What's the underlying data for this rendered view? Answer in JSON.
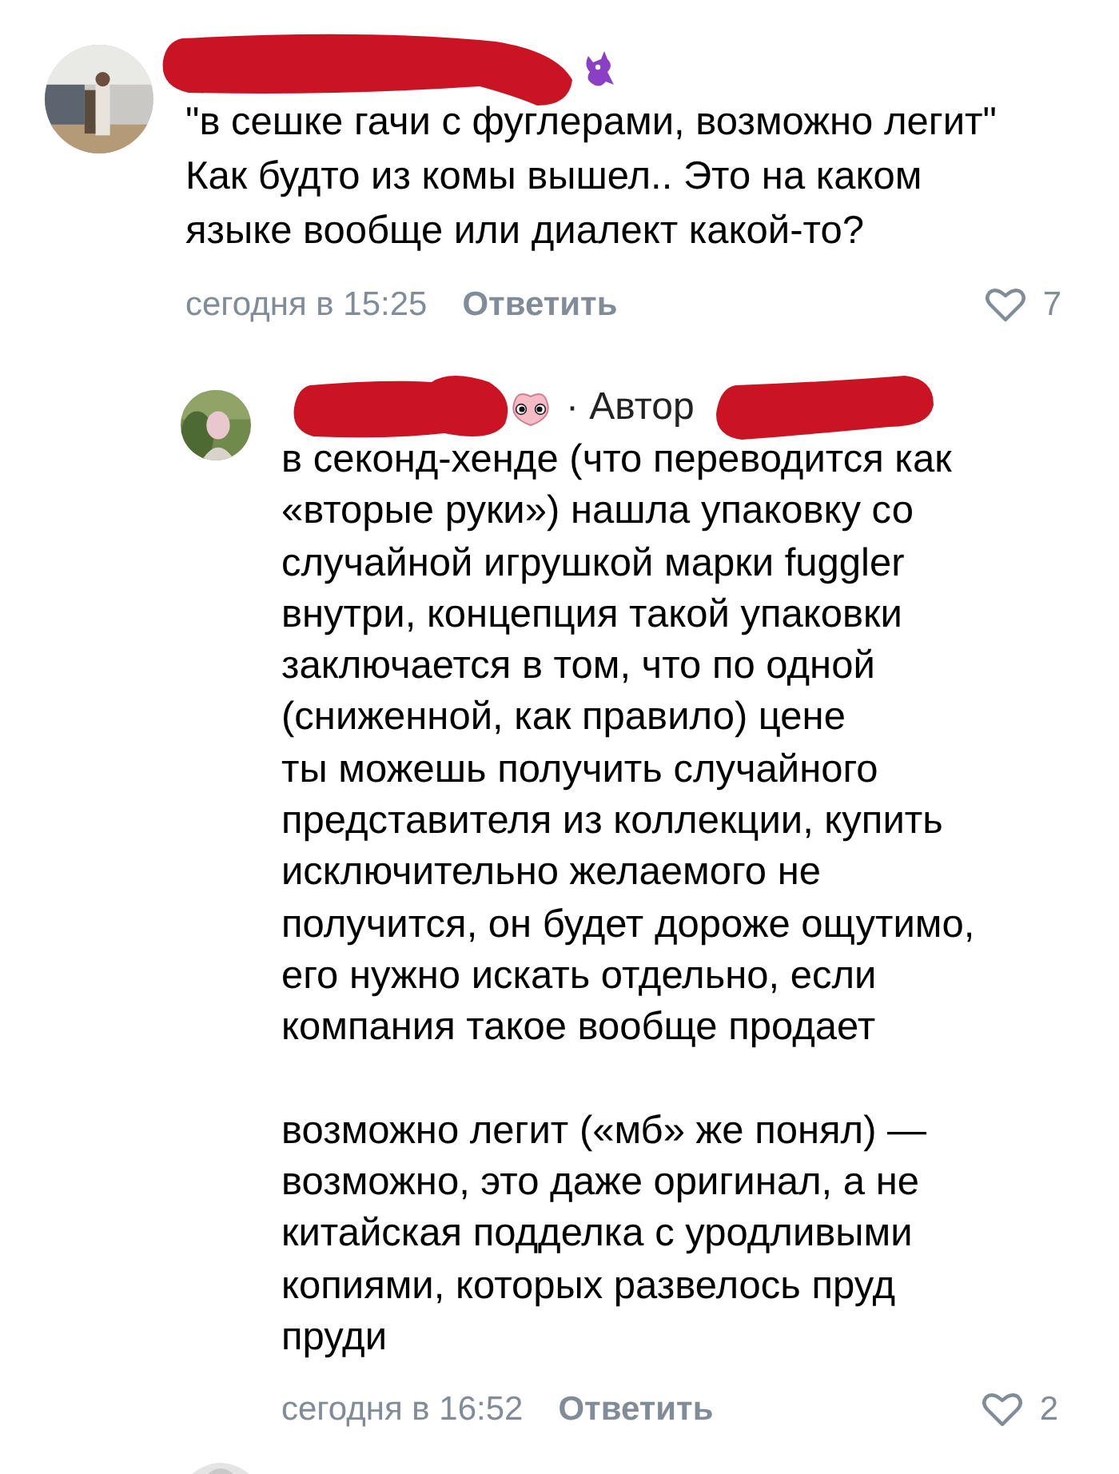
{
  "comments": [
    {
      "kind": "comment",
      "badge": {
        "kind": "dragon"
      },
      "text": "\"в сешке гачи с фуглерами, возможно легит\"\nКак будто из комы вышел.. Это на каком\nязыке вообще или диалект какой-то?",
      "time": "сегодня в 15:25",
      "reply": "Ответить",
      "likes": "7",
      "liked": false
    },
    {
      "kind": "reply",
      "badge": {
        "kind": "face"
      },
      "author_label": "· Автор",
      "text": "в секонд-хенде (что переводится как\n«вторые руки») нашла упаковку со\nслучайной игрушкой марки fuggler\nвнутри, концепция такой упаковки\nзаключается в том, что по одной\n(сниженной, как правило) цене\nты можешь получить случайного\nпредставителя из коллекции, купить\nисключительно желаемого не\nполучится, он будет дороже ощутимо,\nего нужно искать отдельно, если\nкомпания такое вообще продает\n\nвозможно легит («мб» же понял) —\nвозможно, это даже оригинал, а не\nкитайская подделка с уродливыми\nкопиями, которых развелось пруд\nпруди",
      "time": "сегодня в 16:52",
      "reply": "Ответить",
      "likes": "2",
      "liked": false
    }
  ]
}
